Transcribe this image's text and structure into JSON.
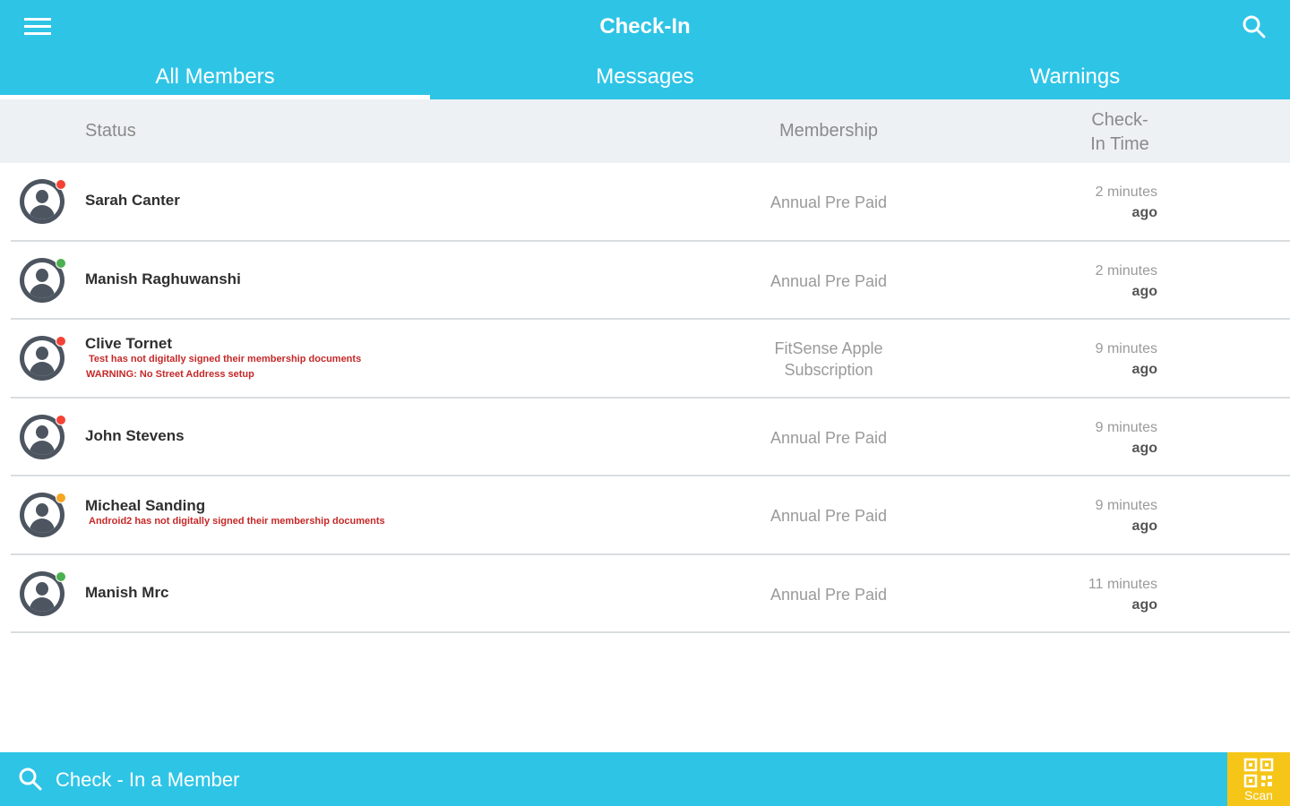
{
  "header": {
    "title": "Check-In",
    "menu_icon": "hamburger-menu-icon",
    "search_icon": "search-icon",
    "color": "#2ec4e6"
  },
  "tabs": [
    {
      "label": "All Members",
      "active": true
    },
    {
      "label": "Messages",
      "active": false
    },
    {
      "label": "Warnings",
      "active": false
    }
  ],
  "columns": {
    "status": "Status",
    "membership": "Membership",
    "time_line1": "Check-",
    "time_line2": "In Time"
  },
  "members": [
    {
      "name": "Sarah Canter",
      "status_color": "#f44336",
      "warnings": [],
      "membership": [
        "Annual Pre Paid"
      ],
      "time": "2 minutes",
      "ago": "ago"
    },
    {
      "name": "Manish Raghuwanshi",
      "status_color": "#4caf50",
      "warnings": [],
      "membership": [
        "Annual Pre Paid"
      ],
      "time": "2 minutes",
      "ago": "ago"
    },
    {
      "name": "Clive Tornet",
      "status_color": "#f44336",
      "warnings": [
        "Test has not digitally signed their membership documents",
        "WARNING: No Street Address setup"
      ],
      "membership": [
        "FitSense Apple",
        "Subscription"
      ],
      "time": "9 minutes",
      "ago": "ago"
    },
    {
      "name": "John Stevens",
      "status_color": "#f44336",
      "warnings": [],
      "membership": [
        "Annual Pre Paid"
      ],
      "time": "9 minutes",
      "ago": "ago"
    },
    {
      "name": "Micheal Sanding",
      "status_color": "#f5a623",
      "warnings": [
        "Android2 has not digitally signed their membership documents"
      ],
      "membership": [
        "Annual Pre Paid"
      ],
      "time": "9 minutes",
      "ago": "ago"
    },
    {
      "name": "Manish Mrc",
      "status_color": "#4caf50",
      "warnings": [],
      "membership": [
        "Annual Pre Paid"
      ],
      "time": "11 minutes",
      "ago": "ago"
    }
  ],
  "bottom": {
    "placeholder": "Check - In a Member",
    "scan_label": "Scan",
    "scan_icon": "qr-code-icon",
    "scan_color": "#f5c518"
  }
}
